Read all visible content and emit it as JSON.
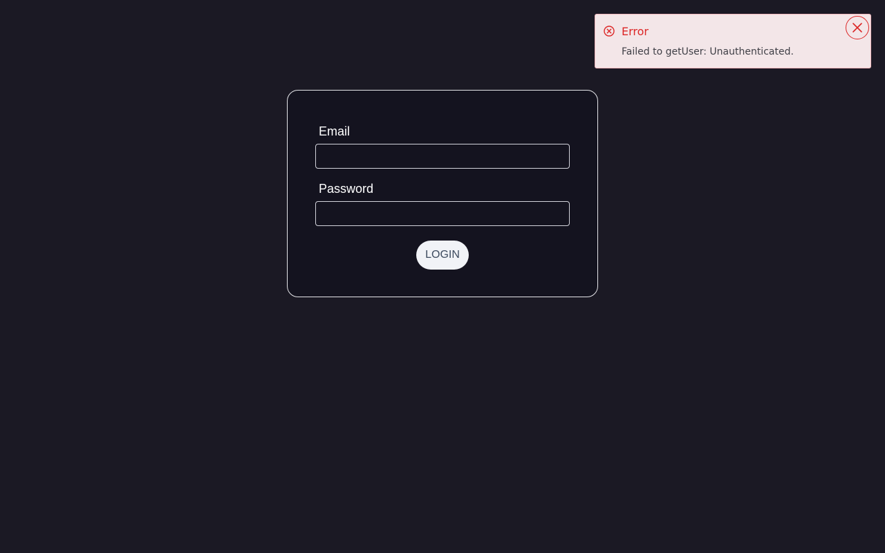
{
  "login": {
    "email_label": "Email",
    "email_value": "",
    "password_label": "Password",
    "password_value": "",
    "login_button_label": "LOGIN"
  },
  "toast": {
    "title": "Error",
    "message": "Failed to getUser: Unauthenticated.",
    "status_icon": "error-circle-x-icon",
    "close_icon": "close-icon",
    "color": "#dc2626"
  },
  "colors": {
    "background": "#1b1924",
    "card": "#14131f",
    "toast_background": "#f3e6e8",
    "error": "#dc2626"
  }
}
